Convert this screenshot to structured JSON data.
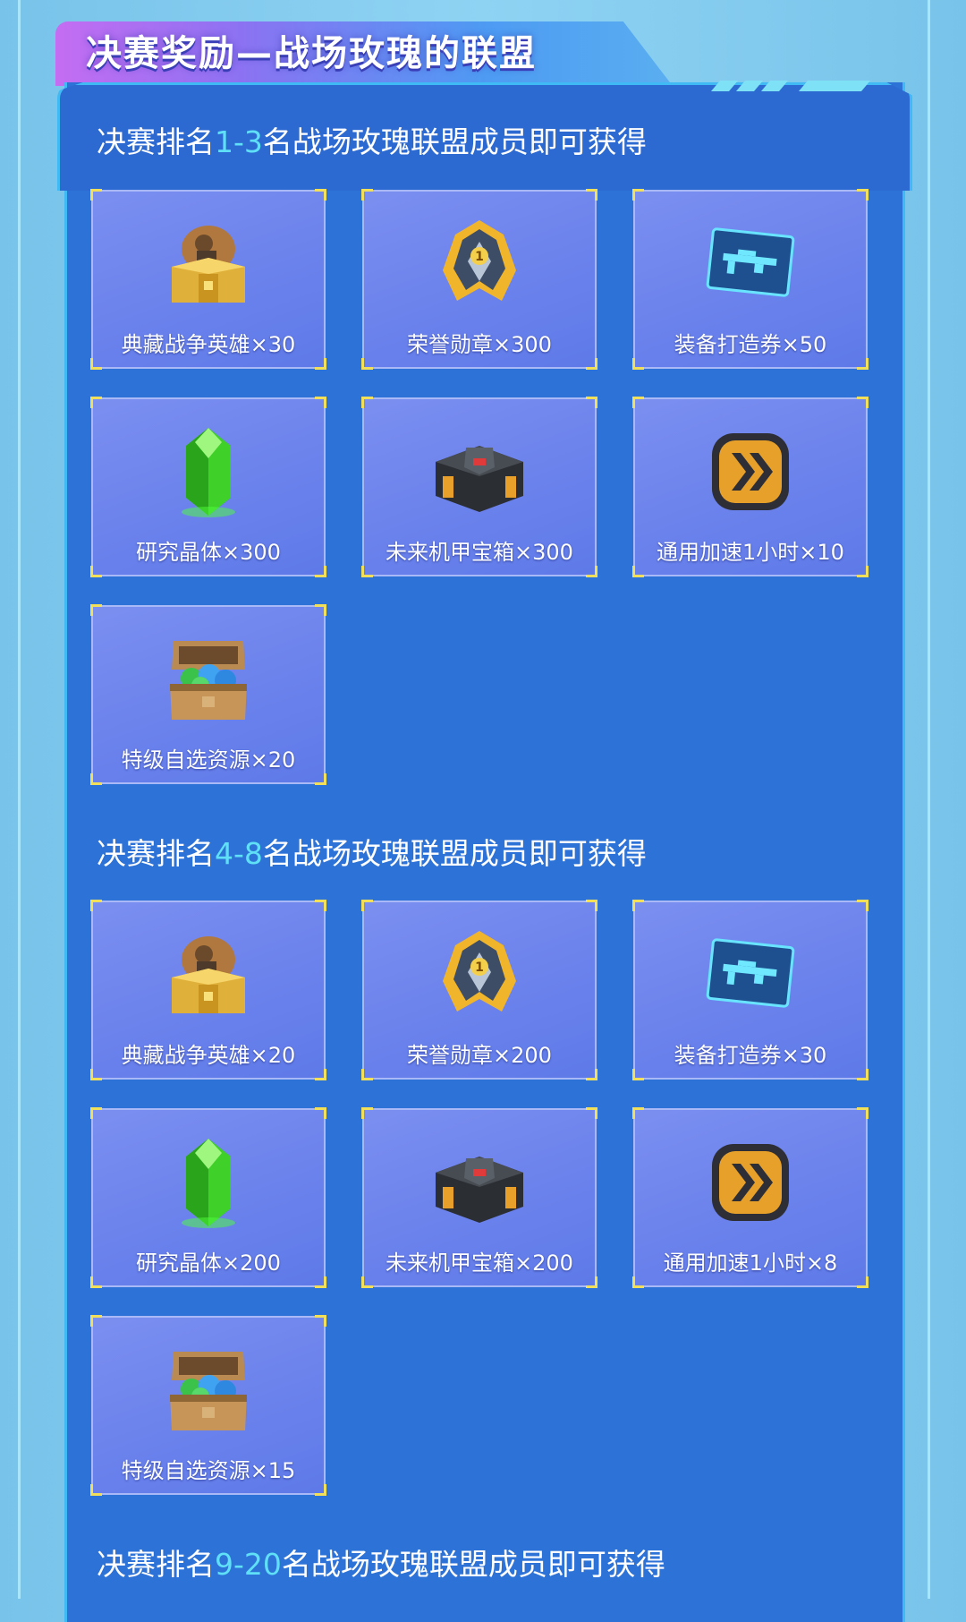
{
  "header": {
    "title": "决赛奖励—战场玫瑰的联盟"
  },
  "sections": [
    {
      "prefix": "决赛排名",
      "rank": "1-3",
      "suffix": "名战场玫瑰联盟成员即可获得",
      "rewards": [
        {
          "icon": "hero-chest-icon",
          "label": "典藏战争英雄×30"
        },
        {
          "icon": "honor-medal-icon",
          "label": "荣誉勋章×300"
        },
        {
          "icon": "weapon-ticket-icon",
          "label": "装备打造券×50"
        },
        {
          "icon": "green-crystal-icon",
          "label": "研究晶体×300"
        },
        {
          "icon": "mech-chest-icon",
          "label": "未来机甲宝箱×300"
        },
        {
          "icon": "speedup-icon",
          "label": "通用加速1小时×10"
        },
        {
          "icon": "resource-chest-icon",
          "label": "特级自选资源×20"
        }
      ]
    },
    {
      "prefix": "决赛排名",
      "rank": "4-8",
      "suffix": "名战场玫瑰联盟成员即可获得",
      "rewards": [
        {
          "icon": "hero-chest-icon",
          "label": "典藏战争英雄×20"
        },
        {
          "icon": "honor-medal-icon",
          "label": "荣誉勋章×200"
        },
        {
          "icon": "weapon-ticket-icon",
          "label": "装备打造券×30"
        },
        {
          "icon": "green-crystal-icon",
          "label": "研究晶体×200"
        },
        {
          "icon": "mech-chest-icon",
          "label": "未来机甲宝箱×200"
        },
        {
          "icon": "speedup-icon",
          "label": "通用加速1小时×8"
        },
        {
          "icon": "resource-chest-icon",
          "label": "特级自选资源×15"
        }
      ]
    },
    {
      "prefix": "决赛排名",
      "rank": "9-20",
      "suffix": "名战场玫瑰联盟成员即可获得",
      "rewards": []
    }
  ]
}
